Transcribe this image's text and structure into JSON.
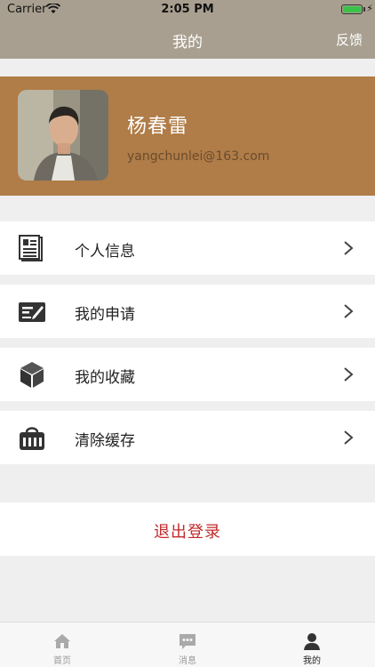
{
  "status": {
    "carrier": "Carrier",
    "time": "2:05 PM"
  },
  "nav": {
    "title": "我的",
    "feedback": "反馈"
  },
  "profile": {
    "name": "杨春雷",
    "email": "yangchunlei@163.com"
  },
  "menu": [
    {
      "label": "个人信息",
      "icon": "id-card-icon"
    },
    {
      "label": "我的申请",
      "icon": "application-icon"
    },
    {
      "label": "我的收藏",
      "icon": "box-icon"
    },
    {
      "label": "清除缓存",
      "icon": "basket-icon"
    }
  ],
  "logout": "退出登录",
  "tabs": [
    {
      "label": "首页",
      "icon": "home-icon"
    },
    {
      "label": "消息",
      "icon": "message-icon"
    },
    {
      "label": "我的",
      "icon": "person-icon",
      "active": true
    }
  ],
  "colors": {
    "nav_bg": "#a89f90",
    "profile_bg": "#b07c47",
    "logout_text": "#c22a2a",
    "battery": "#3cc24a"
  }
}
